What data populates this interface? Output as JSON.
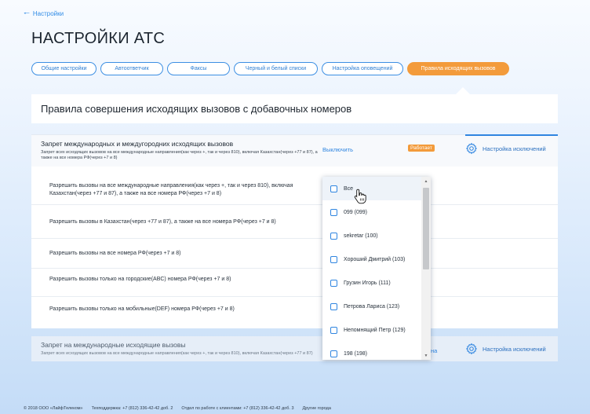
{
  "nav": {
    "back_label": "Настройки"
  },
  "page": {
    "title": "НАСТРОЙКИ АТС"
  },
  "tabs": [
    {
      "label": "Общие настройки"
    },
    {
      "label": "Автоответчик"
    },
    {
      "label": "Факсы"
    },
    {
      "label": "Черный и белый списки"
    },
    {
      "label": "Настройка оповещений"
    },
    {
      "label": "Правила исходящих вызовов",
      "active": true
    }
  ],
  "section": {
    "title": "Правила совершения исходящих вызовов с добавочных номеров"
  },
  "rule1": {
    "title": "Запрет международных и междугородних исходящих вызовов",
    "description": "Запрет всех исходящих вызовов на все международные направления(как через +, так и через 810), включая Казахстан(через +77 и 87), а также на все номера РФ(через +7 и 8)",
    "disable_label": "Выключить",
    "status_badge": "Работает",
    "settings_label": "Настройка исключений"
  },
  "options": [
    {
      "text": "Разрешить вызовы на все международные направления(как через +, так и через 810), включая Казахстан(через +77 и 87), а также на все номера РФ(через +7 и 8)"
    },
    {
      "text": "Разрешить вызовы в Казахстан(через +77 и 87), а также на все номера РФ(через +7 и 8)"
    },
    {
      "text": "Разрешить вызовы на все номера РФ(через +7 и 8)"
    },
    {
      "text": "Разрешить вызовы только на городские(ABC) номера РФ(через +7 и 8)"
    },
    {
      "text": "Разрешить вызовы только на мобильные(DEF) номера РФ(через +7 и 8)"
    }
  ],
  "rule2": {
    "title": "Запрет на международные исходящие вызовы",
    "description": "Запрет всех исходящих вызовов на все международные направления(как через +, так и через 810), включая Казахстан(через +77 и 87)",
    "link_fragment": "на",
    "settings_label": "Настройка исключений"
  },
  "dropdown": {
    "items": [
      {
        "label": "Все"
      },
      {
        "label": "099 (099)"
      },
      {
        "label": "sekretar (100)"
      },
      {
        "label": "Хороший Дмитрий (103)"
      },
      {
        "label": "Грузин Игорь (111)"
      },
      {
        "label": "Петрова Лариса (123)"
      },
      {
        "label": "Непомнящий Петр (129)"
      },
      {
        "label": "198 (198)"
      }
    ]
  },
  "footer": {
    "copyright": "© 2018 ООО «ЛайфТелеком»",
    "support": "Техподдержка: +7 (812) 336-42-42 доб. 2",
    "clients": "Отдел по работе с клиентами: +7 (812) 336-42-42 доб. 3",
    "other_cities": "Другие города"
  },
  "colors": {
    "accent": "#2f85e0",
    "active_tab": "#f39b3b",
    "badge": "#f39b3b"
  }
}
